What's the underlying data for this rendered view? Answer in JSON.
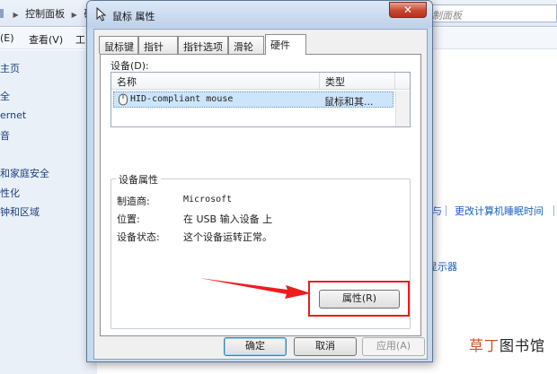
{
  "background_window": {
    "breadcrumb": "控制面板",
    "breadcrumb_cut": "硬",
    "search_placeholder": "制面板",
    "menu": {
      "edit": "(E)",
      "view": "查看(V)",
      "tools": "工"
    },
    "sidebar": [
      "主页",
      "全",
      "ernet",
      "音",
      "和家庭安全",
      "性化",
      "钟和区域"
    ],
    "links": {
      "partial_left": "与",
      "sleep_time": "更改计算机睡眠时间",
      "display": "显示器"
    },
    "watermark": {
      "accent": "草丁",
      "rest": "图书馆"
    }
  },
  "dialog": {
    "title": "鼠标 属性",
    "close_glyph": "✕",
    "tabs": [
      {
        "label": "鼠标键",
        "active": false
      },
      {
        "label": "指针",
        "active": false
      },
      {
        "label": "指针选项",
        "active": false
      },
      {
        "label": "滑轮",
        "active": false
      },
      {
        "label": "硬件",
        "active": true
      }
    ],
    "devices_label": "设备(D):",
    "device_columns": {
      "name": "名称",
      "type": "类型"
    },
    "devices": [
      {
        "name": "HID-compliant mouse",
        "type": "鼠标和其..."
      }
    ],
    "device_properties": {
      "title": "设备属性",
      "manufacturer_label": "制造商:",
      "manufacturer_value": "Microsoft",
      "location_label": "位置:",
      "location_value": "在 USB 输入设备 上",
      "status_label": "设备状态:",
      "status_value": "这个设备运转正常。"
    },
    "properties_button": "属性(R)",
    "buttons": {
      "ok": "确定",
      "cancel": "取消",
      "apply": "应用(A)"
    }
  },
  "colors": {
    "highlight": "#ee1c1c",
    "selected_row": "#cde5fb",
    "dialog_frame": "#c7d9ee",
    "link": "#1560c2"
  },
  "icons": [
    "arrow-cursor-icon",
    "mouse-icon",
    "close-icon",
    "chevron-right-icon"
  ]
}
